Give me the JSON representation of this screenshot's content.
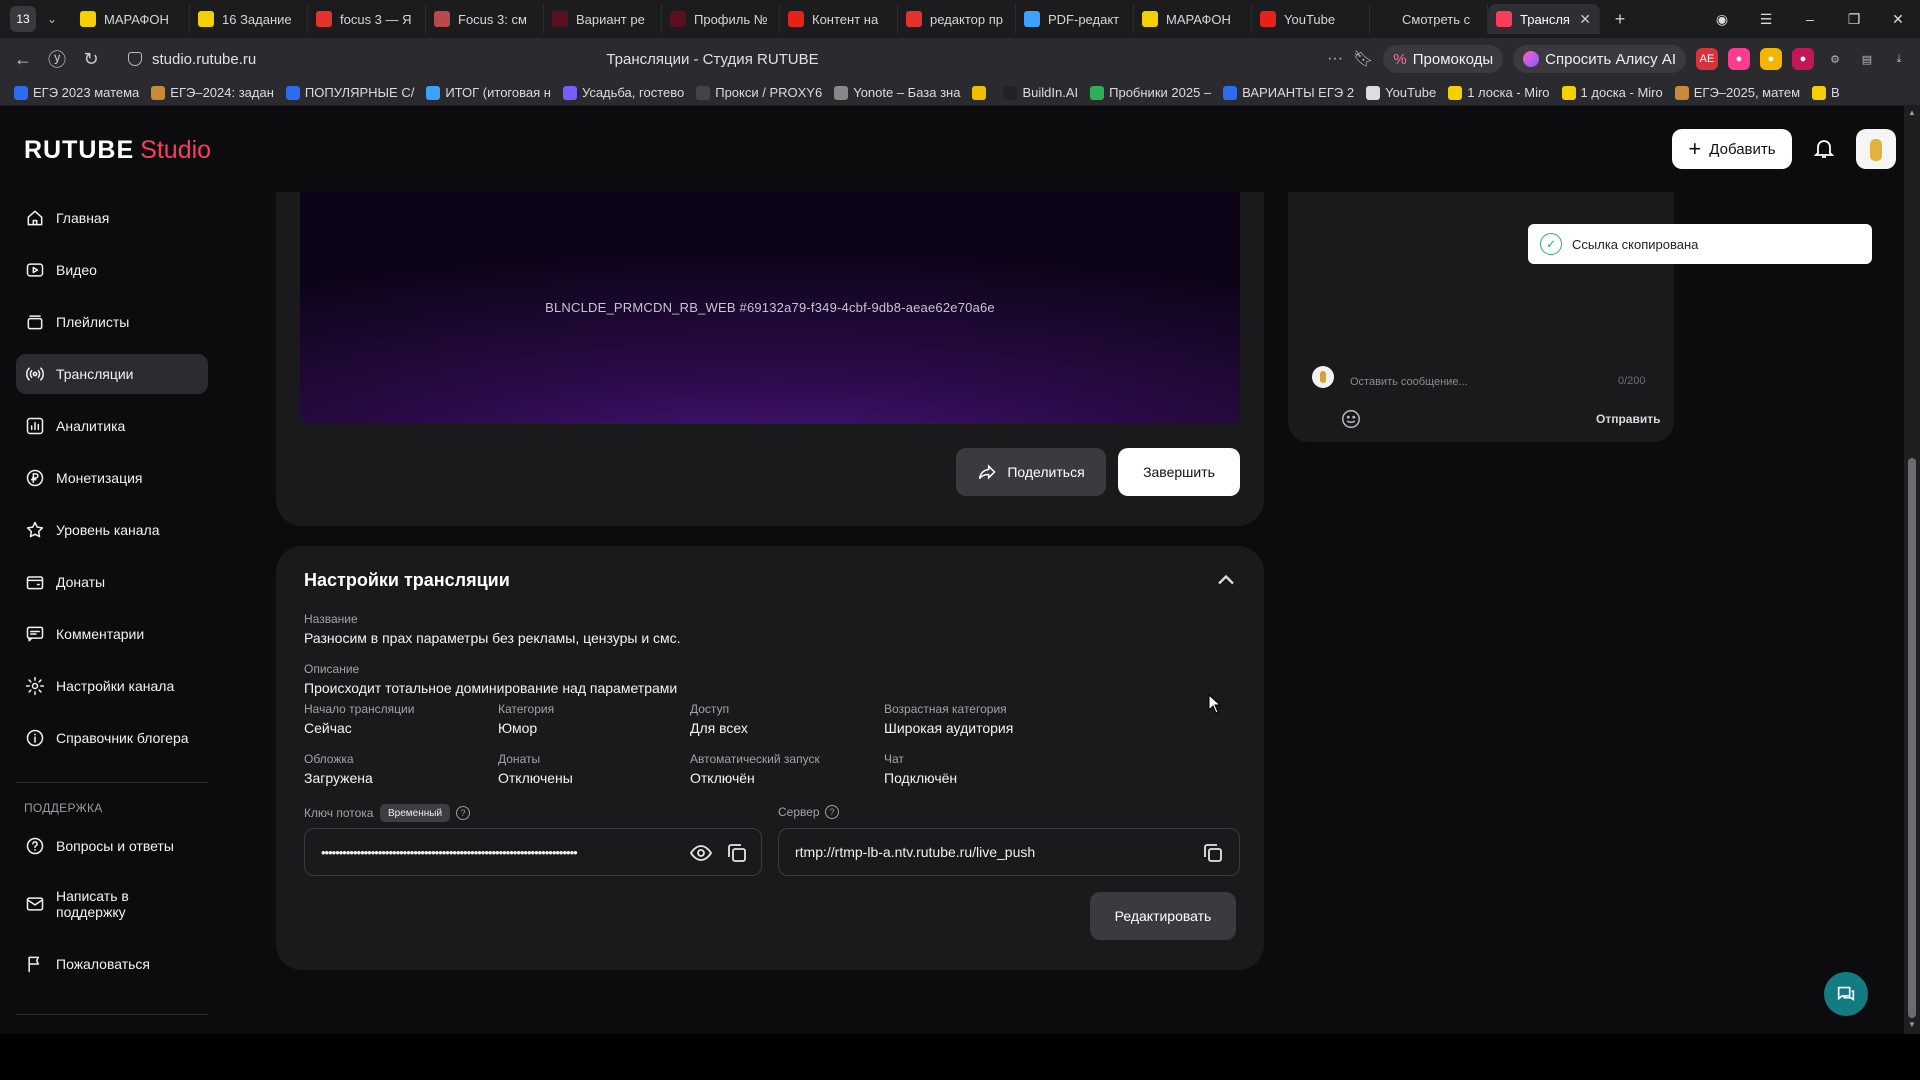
{
  "browser": {
    "tab_counter": "13",
    "tabs": [
      {
        "label": "МАРАФОН",
        "icon": "yandex-market-icon",
        "color": "#f5d000"
      },
      {
        "label": "16 Задание",
        "icon": "yandex-market-icon",
        "color": "#f5d000"
      },
      {
        "label": "focus 3 — Я",
        "icon": "yandex-icon",
        "color": "#e5322d"
      },
      {
        "label": "Focus 3: cм",
        "icon": "focus-icon",
        "color": "#b84a4a"
      },
      {
        "label": "Вариант ре",
        "icon": "red-icon",
        "color": "#5a1020"
      },
      {
        "label": "Профиль №",
        "icon": "red-icon",
        "color": "#5a1020"
      },
      {
        "label": "Контент на",
        "icon": "youtube-icon",
        "color": "#e62117"
      },
      {
        "label": "редактор пр",
        "icon": "yandex-icon",
        "color": "#e5322d"
      },
      {
        "label": "PDF-редакт",
        "icon": "pdf-icon",
        "color": "#3ca1ff"
      },
      {
        "label": "МАРАФОН",
        "icon": "yandex-market-icon",
        "color": "#f5d000"
      },
      {
        "label": "YouTube",
        "icon": "youtube-icon",
        "color": "#e62117"
      },
      {
        "label": "Смотреть с",
        "icon": "rutube-icon",
        "color": "#1c1c1f"
      },
      {
        "label": "Трансля",
        "icon": "studio-icon",
        "color": "#ff3b5c",
        "active": true
      }
    ],
    "url": "studio.rutube.ru",
    "page_title": "Трансляции - Студия RUTUBE",
    "promo_label": "Промокоды",
    "alice_label": "Спросить Алису AI",
    "bookmarks": [
      {
        "label": "ЕГЭ 2023 матема",
        "color": "#2b6cf0"
      },
      {
        "label": "ЕГЭ–2024: задан",
        "color": "#c98b3a"
      },
      {
        "label": "ПОПУЛЯРНЫЕ С/",
        "color": "#2b6cf0"
      },
      {
        "label": "ИТОГ (итоговая н",
        "color": "#3ca1ff"
      },
      {
        "label": "Усадьба, гостево",
        "color": "#7a5cff"
      },
      {
        "label": "Прокси / PROXY6",
        "color": "#444"
      },
      {
        "label": "Yonote – База зна",
        "color": "#888"
      },
      {
        "label": "",
        "color": "#f0c000"
      },
      {
        "label": "BuildIn.AI",
        "color": "#222"
      },
      {
        "label": "Пробники 2025 –",
        "color": "#2fae5a"
      },
      {
        "label": "ВАРИАНТЫ ЕГЭ 2",
        "color": "#2b6cf0"
      },
      {
        "label": "YouTube",
        "color": "#ddd"
      },
      {
        "label": "1 лоска - Miro",
        "color": "#f5d000"
      },
      {
        "label": "1 доска - Miro",
        "color": "#f5d000"
      },
      {
        "label": "ЕГЭ–2025, матем",
        "color": "#c98b3a"
      },
      {
        "label": "В",
        "color": "#f5d000"
      }
    ]
  },
  "header": {
    "logo_main": "RUTUBE",
    "logo_studio": "Studio",
    "add_label": "Добавить"
  },
  "sidebar": {
    "items": [
      {
        "label": "Главная",
        "icon": "home-icon"
      },
      {
        "label": "Видео",
        "icon": "video-icon"
      },
      {
        "label": "Плейлисты",
        "icon": "playlist-icon"
      },
      {
        "label": "Трансляции",
        "icon": "broadcast-icon",
        "active": true
      },
      {
        "label": "Аналитика",
        "icon": "analytics-icon"
      },
      {
        "label": "Монетизация",
        "icon": "ruble-icon"
      },
      {
        "label": "Уровень канала",
        "icon": "star-icon"
      },
      {
        "label": "Донаты",
        "icon": "wallet-icon"
      },
      {
        "label": "Комментарии",
        "icon": "comment-icon"
      },
      {
        "label": "Настройки канала",
        "icon": "gear-icon"
      },
      {
        "label": "Справочник блогера",
        "icon": "info-icon"
      }
    ],
    "support_title": "ПОДДЕРЖКА",
    "support_items": [
      {
        "label": "Вопросы и ответы",
        "icon": "question-icon"
      },
      {
        "label": "Написать в поддержку",
        "icon": "mail-icon"
      },
      {
        "label": "Пожаловаться",
        "icon": "flag-icon"
      }
    ]
  },
  "player": {
    "video_id": "BLNCLDE_PRMCDN_RB_WEB #69132a79-f349-4cbf-9db8-aeae62e70a6e",
    "share_label": "Поделиться",
    "finish_label": "Завершить"
  },
  "settings": {
    "title": "Настройки трансляции",
    "name_label": "Название",
    "name_value": "Разносим в прах параметры без рекламы, цензуры и смс.",
    "desc_label": "Описание",
    "desc_value": "Происходит тотальное доминирование над параметрами",
    "grid": [
      {
        "label": "Начало трансляции",
        "value": "Сейчас"
      },
      {
        "label": "Категория",
        "value": "Юмор"
      },
      {
        "label": "Доступ",
        "value": "Для всех"
      },
      {
        "label": "Возрастная категория",
        "value": "Широкая аудитория"
      },
      {
        "label": "Обложка",
        "value": "Загружена"
      },
      {
        "label": "Донаты",
        "value": "Отключены"
      },
      {
        "label": "Автоматический запуск",
        "value": "Отключён"
      },
      {
        "label": "Чат",
        "value": "Подключён"
      }
    ],
    "key_label": "Ключ потока",
    "key_badge": "Временный",
    "key_value": "••••••••••••••••••••••••••••••••••••••••••••••••••••••••••••••••••••••••",
    "server_label": "Сервер",
    "server_value": "rtmp://rtmp-lb-a.ntv.rutube.ru/live_push",
    "edit_label": "Редактировать"
  },
  "chat": {
    "placeholder": "Оставить сообщение...",
    "counter": "0/200",
    "send_label": "Отправить"
  },
  "toast": {
    "message": "Ссылка скопирована"
  }
}
